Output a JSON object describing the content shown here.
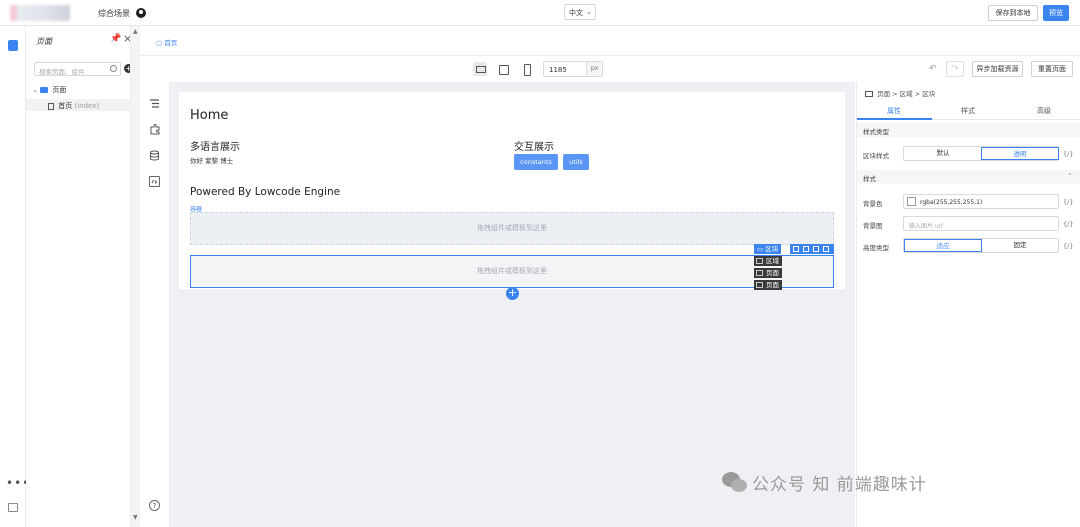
{
  "topbar": {
    "scene_title": "综合场景",
    "lang": "中文",
    "save_label": "保存到本地",
    "preview_label": "预览"
  },
  "tree": {
    "title": "页面",
    "search_placeholder": "搜索页面、组件",
    "folder_label": "页面",
    "page_label": "首页",
    "page_slug": "(index)"
  },
  "tabs": {
    "home": "首页"
  },
  "toolbar": {
    "width_value": "1185",
    "width_unit": "px",
    "async_load_label": "异步加载资源",
    "reset_label": "重置页面"
  },
  "canvas": {
    "home_title": "Home",
    "i18n_title": "多语言展示",
    "i18n_text": "你好  紫黎 博士",
    "interact_title": "交互展示",
    "btn_constants": "constants",
    "btn_utils": "utils",
    "powered_title": "Powered By Lowcode Engine",
    "container_tag": "容器",
    "dropzone_text": "拖拽组件或模板到这里",
    "sel_label": "区块"
  },
  "crumb_popup": [
    "区域",
    "页面",
    "页面"
  ],
  "settings": {
    "crumb": [
      "页面",
      "区域",
      "区块"
    ],
    "tabs": [
      "属性",
      "样式",
      "高级"
    ],
    "section_style_type": "样式类型",
    "block_style_label": "区块样式",
    "block_style_options": [
      "默认",
      "透明"
    ],
    "section_style": "样式",
    "bg_color_label": "背景色",
    "bg_color_value": "rgba(255,255,255,1)",
    "bg_image_label": "背景图",
    "bg_image_placeholder": "输入图片 url",
    "height_type_label": "高度类型",
    "height_type_options": [
      "适应",
      "固定"
    ],
    "fx": "{/}"
  },
  "watermark": "公众号 知 前端趣味计",
  "colors": {
    "accent": "#3b84f0",
    "canvas_bg": "#eef0f3"
  }
}
